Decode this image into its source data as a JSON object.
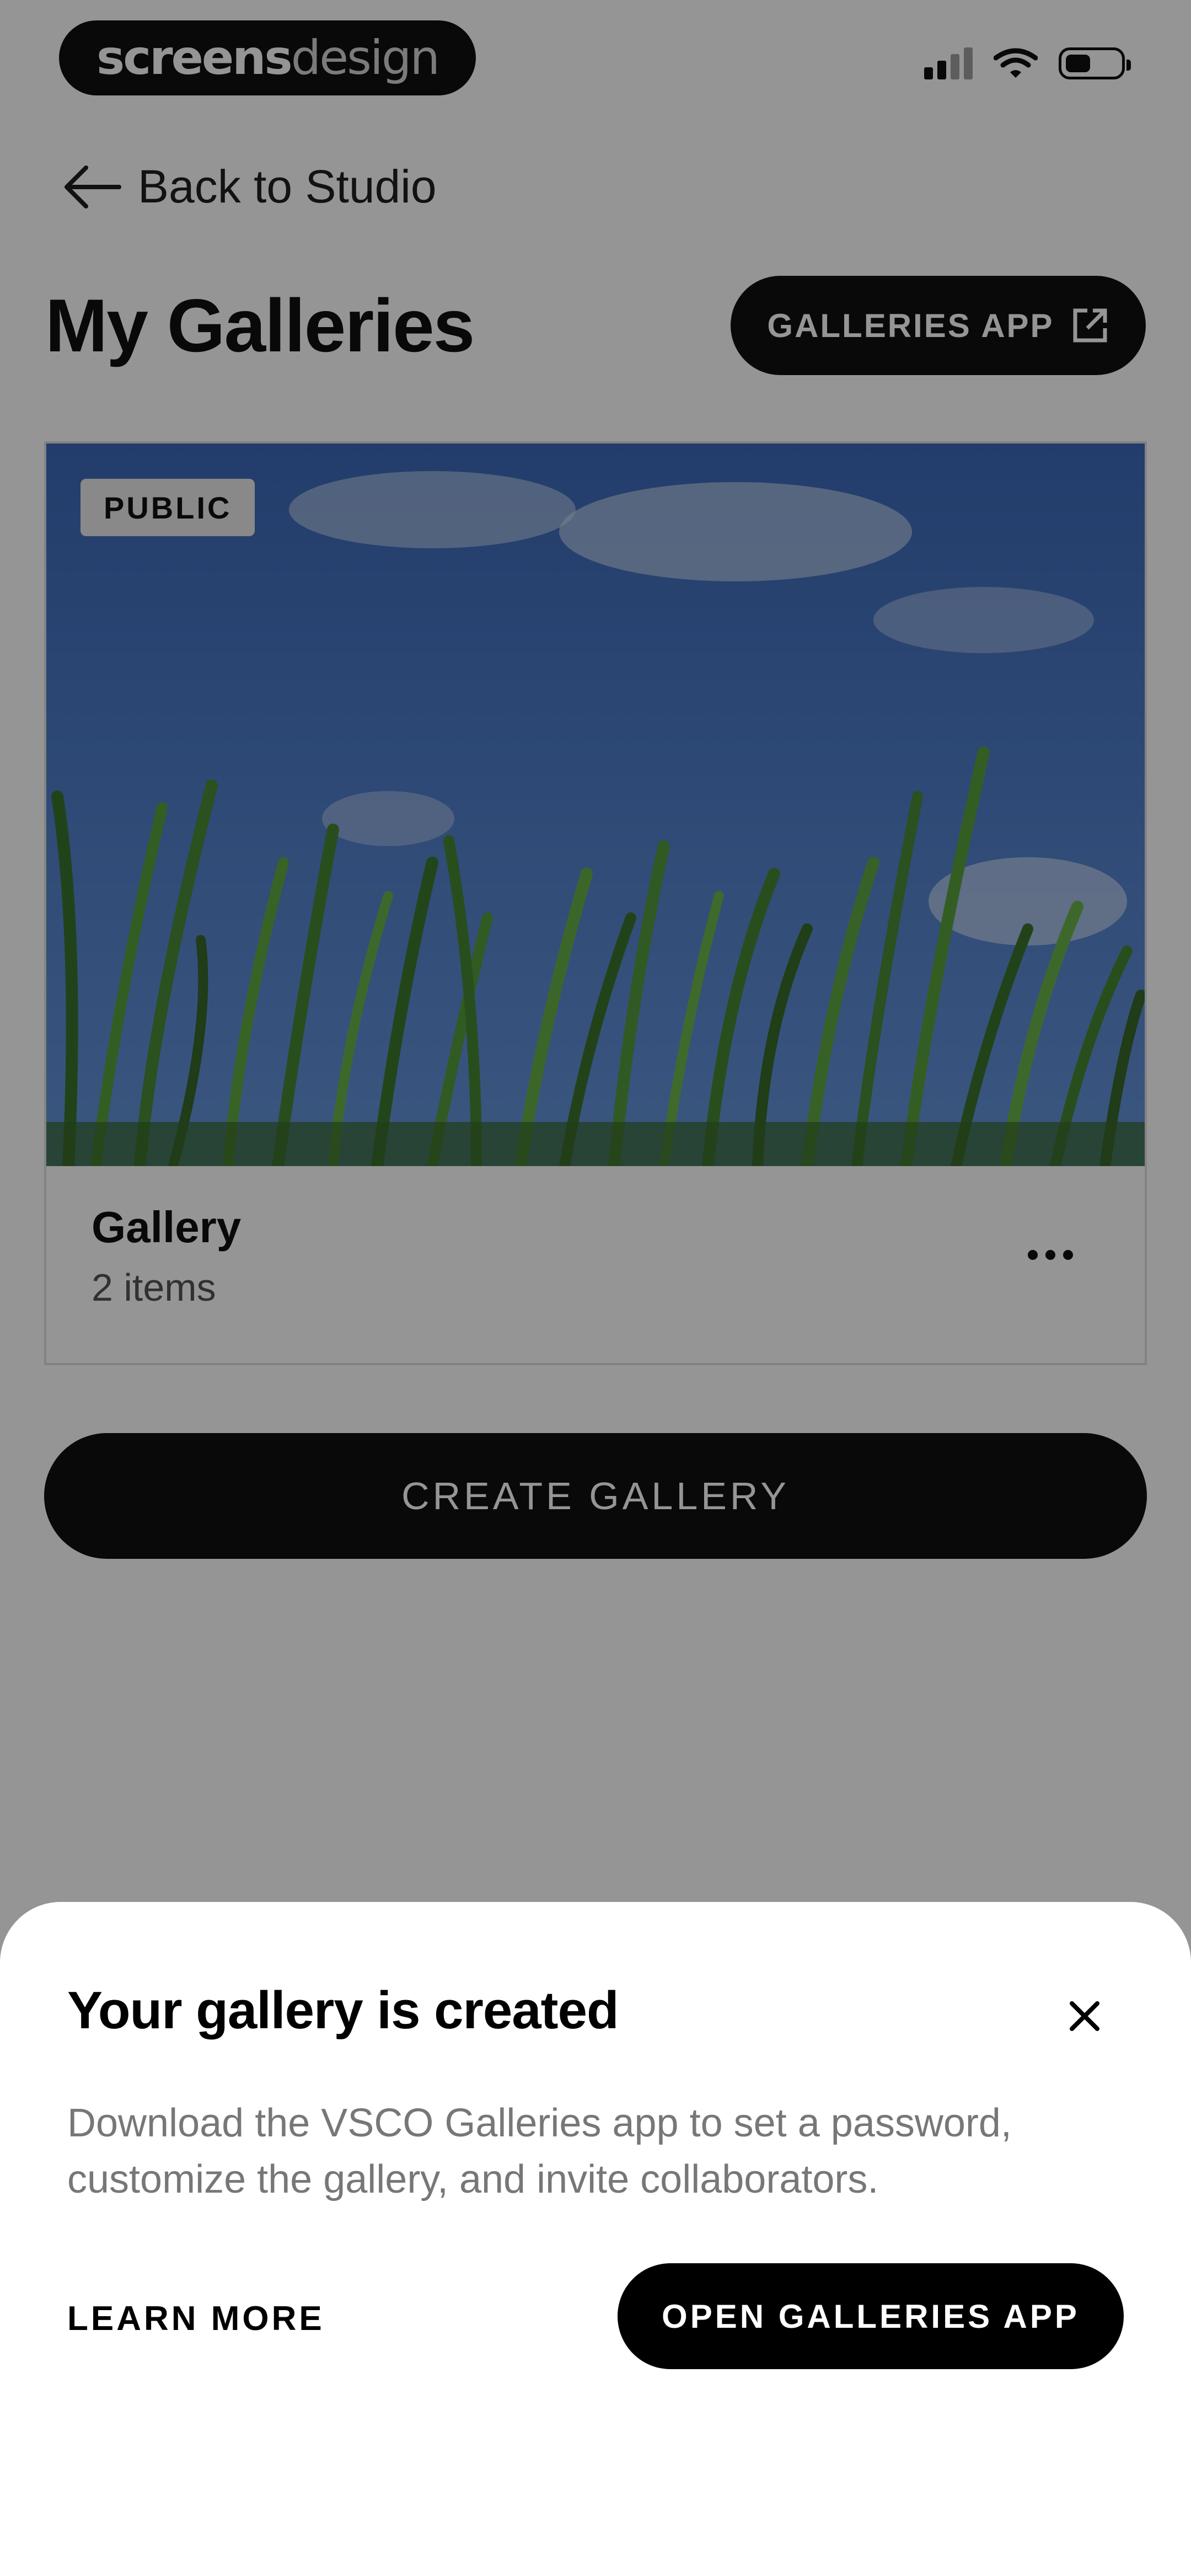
{
  "status_bar": {
    "brand_part1": "screens",
    "brand_part2": "design",
    "icons": [
      "signal-icon",
      "wifi-icon",
      "battery-icon"
    ]
  },
  "nav": {
    "back_label": "Back to Studio"
  },
  "header": {
    "title": "My Galleries",
    "galleries_app_label": "GALLERIES APP"
  },
  "gallery_card": {
    "badge": "PUBLIC",
    "title": "Gallery",
    "item_count": "2 items"
  },
  "create_button_label": "CREATE GALLERY",
  "sheet": {
    "title": "Your gallery is created",
    "body": "Download the VSCO Galleries app to set a password, customize the gallery, and invite collaborators.",
    "learn_more_label": "LEARN MORE",
    "open_app_label": "OPEN GALLERIES APP"
  },
  "colors": {
    "primary": "#000000",
    "overlay": "rgba(20,20,20,0.45)",
    "sky": "#3a70c4",
    "grass": "#3e8a2a"
  }
}
